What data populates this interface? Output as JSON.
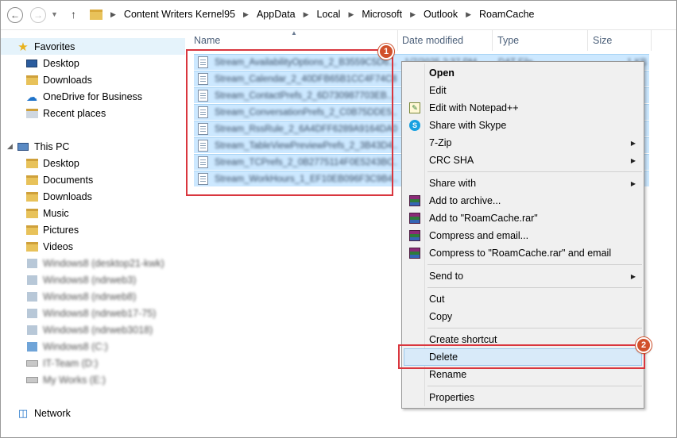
{
  "breadcrumbs": [
    "Content Writers Kernel95",
    "AppData",
    "Local",
    "Microsoft",
    "Outlook",
    "RoamCache"
  ],
  "nav": {
    "favorites": {
      "label": "Favorites",
      "items": [
        "Desktop",
        "Downloads",
        "OneDrive for Business",
        "Recent places"
      ]
    },
    "this_pc": {
      "label": "This PC",
      "items": [
        "Desktop",
        "Documents",
        "Downloads",
        "Music",
        "Pictures",
        "Videos"
      ]
    },
    "blurred_items": [
      "Windows8 (desktop21-kwk)",
      "Windows8 (ndrweb3)",
      "Windows8 (ndrweb8)",
      "Windows8 (ndrweb17-75)",
      "Windows8 (ndrweb3018)",
      "Windows8 (C:)",
      "IT-Team (D:)",
      "My Works (E:)"
    ],
    "network": "Network"
  },
  "columns": {
    "name": "Name",
    "date": "Date modified",
    "type": "Type",
    "size": "Size"
  },
  "files": [
    {
      "name": "Stream_AvailabilityOptions_2_B3559C5D6...",
      "date": "1/7/2025 2:37 PM",
      "type": "DAT File",
      "size": "1 KB"
    },
    {
      "name": "Stream_Calendar_2_40DFB65B1CC4F74C8...",
      "date": "",
      "type": "",
      "size": ""
    },
    {
      "name": "Stream_ContactPrefs_2_6D730987703EB...",
      "date": "",
      "type": "",
      "size": ""
    },
    {
      "name": "Stream_ConversationPrefs_2_C0B75DDE5...",
      "date": "",
      "type": "",
      "size": ""
    },
    {
      "name": "Stream_RssRule_2_6A4DFF6289A9164DA0...",
      "date": "",
      "type": "",
      "size": ""
    },
    {
      "name": "Stream_TableViewPreviewPrefs_2_3B43D4...",
      "date": "",
      "type": "",
      "size": ""
    },
    {
      "name": "Stream_TCPrefs_2_0B2775114F0E5243BC...",
      "date": "",
      "type": "",
      "size": ""
    },
    {
      "name": "Stream_WorkHours_1_EF10EB096F3C9B4...",
      "date": "",
      "type": "",
      "size": ""
    }
  ],
  "badges": {
    "one": "1",
    "two": "2"
  },
  "menu": {
    "open": "Open",
    "edit": "Edit",
    "edit_notepad": "Edit with Notepad++",
    "share_skype": "Share with Skype",
    "zip7": "7-Zip",
    "crc": "CRC SHA",
    "share_with": "Share with",
    "add_archive": "Add to archive...",
    "add_rar": "Add to \"RoamCache.rar\"",
    "compress_email": "Compress and email...",
    "compress_rar_email": "Compress to \"RoamCache.rar\" and email",
    "send_to": "Send to",
    "cut": "Cut",
    "copy": "Copy",
    "create_shortcut": "Create shortcut",
    "delete": "Delete",
    "rename": "Rename",
    "properties": "Properties"
  },
  "colors": {
    "selection": "#cce8ff",
    "annotation": "#d9363e",
    "badge": "#d1502b"
  }
}
